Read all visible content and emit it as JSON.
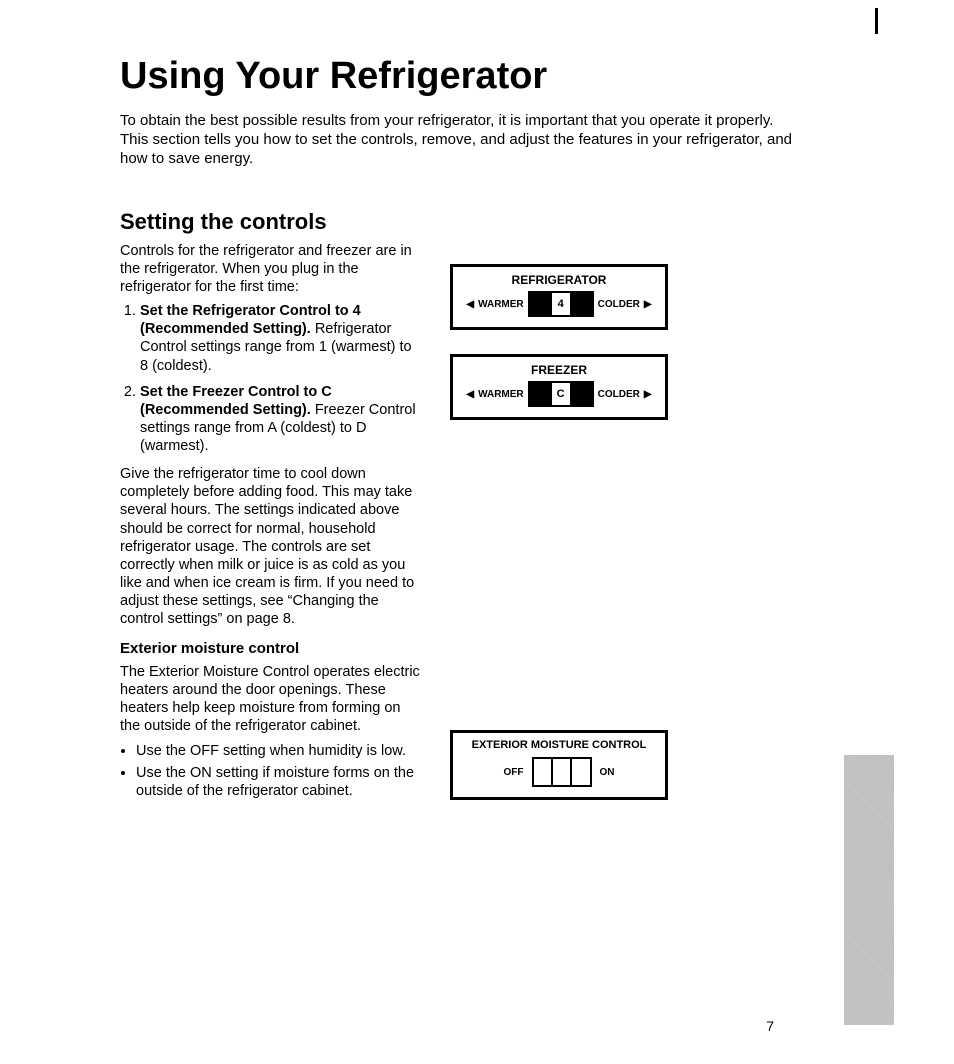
{
  "title": "Using Your Refrigerator",
  "intro": "To obtain the best possible results from your refrigerator, it is important that you operate it properly. This section tells you how to set the controls, remove, and adjust the features in your refrigerator, and how to save energy.",
  "section": {
    "title": "Setting the controls",
    "lede": "Controls for the refrigerator and freezer are in the refrigerator. When you plug in the refrigerator for the first time:",
    "steps": [
      {
        "bold": "Set the Refrigerator Control to 4 (Recommended Setting).",
        "rest": " Refrigerator Control settings range from 1 (warmest) to 8 (coldest)."
      },
      {
        "bold": "Set the Freezer Control to C (Recommended Setting).",
        "rest": " Freezer Control settings range from A (coldest) to D (warmest)."
      }
    ],
    "after": "Give the refrigerator time to cool down completely before adding food. This may take several hours. The settings indicated above should be correct for normal, household refrigerator usage. The controls are set correctly when milk or juice is as cold as you like and when ice cream is firm. If you need to adjust these settings, see “Changing the control settings” on page 8.",
    "sub": {
      "title": "Exterior moisture control",
      "body": "The Exterior Moisture Control operates electric heaters around the door openings. These heaters help keep moisture from forming on the outside of the refrigerator cabinet.",
      "bullets": [
        "Use the OFF setting when humidity is low.",
        "Use the ON setting if moisture forms on the outside of the refrigerator cabinet."
      ]
    }
  },
  "panels": {
    "refrigerator": {
      "title": "REFRIGERATOR",
      "left": "WARMER",
      "value": "4",
      "right": "COLDER"
    },
    "freezer": {
      "title": "FREEZER",
      "left": "WARMER",
      "value": "C",
      "right": "COLDER"
    },
    "emc": {
      "title": "EXTERIOR MOISTURE CONTROL",
      "off": "OFF",
      "on": "ON"
    }
  },
  "page_number": "7"
}
